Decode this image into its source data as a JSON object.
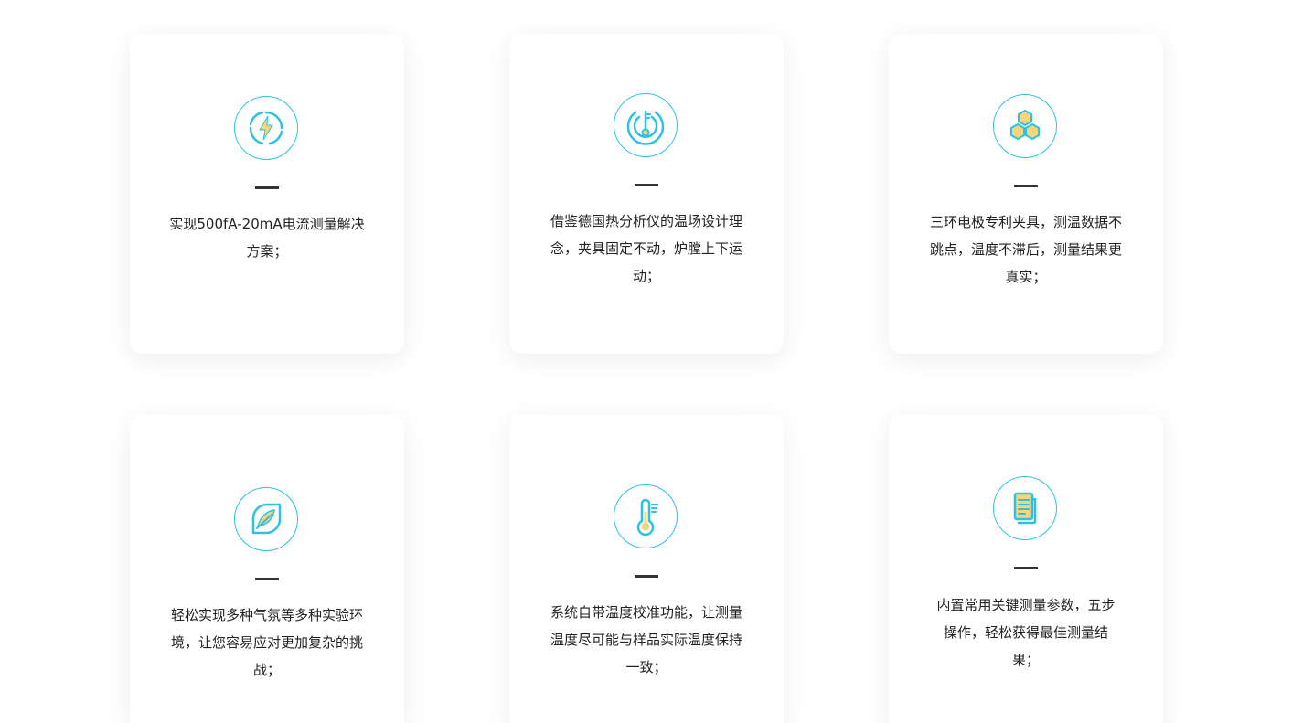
{
  "features": [
    {
      "icon": "lightning-icon",
      "text": "实现500fA-20mA电流测量解决方案；"
    },
    {
      "icon": "key-icon",
      "text": "借鉴德国热分析仪的温场设计理念，夹具固定不动，炉膛上下运动；"
    },
    {
      "icon": "hexagons-icon",
      "text": "三环电极专利夹具，测温数据不跳点，温度不滞后，测量结果更真实；"
    },
    {
      "icon": "leaf-icon",
      "text": "轻松实现多种气氛等多种实验环境，让您容易应对更加复杂的挑战；"
    },
    {
      "icon": "thermometer-icon",
      "text": "系统自带温度校准功能，让测量温度尽可能与样品实际温度保持一致；"
    },
    {
      "icon": "document-icon",
      "text": "内置常用关键测量参数，五步操作，轻松获得最佳测量结果；"
    }
  ],
  "colors": {
    "accent": "#2ec1e3",
    "icon_fill": "#f6d57c",
    "divider": "#333333",
    "text": "#222222"
  }
}
